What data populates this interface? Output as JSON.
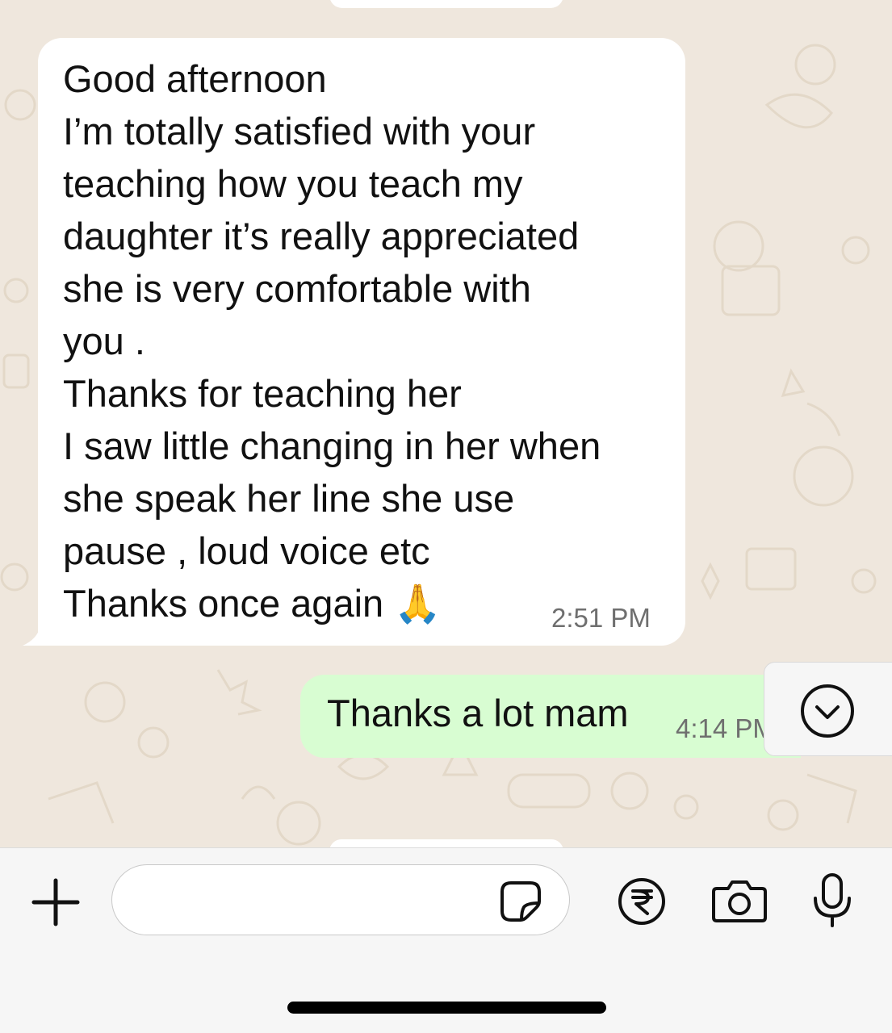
{
  "incoming_message": {
    "lines": [
      "Good afternoon",
      "I’m totally satisfied with your",
      "teaching how you teach my",
      "daughter it’s really appreciated",
      "she is very comfortable with",
      "you .",
      "Thanks for teaching her",
      "I saw little changing in her when",
      "she speak her line she use",
      "pause , loud voice etc",
      "Thanks once again 🙏"
    ],
    "time": "2:51 PM"
  },
  "outgoing_message": {
    "text": "Thanks a lot mam",
    "time": "4:14 PM"
  },
  "composer": {
    "input_value": "",
    "placeholder": ""
  },
  "colors": {
    "chat_background": "#efe7dd",
    "outgoing_bubble": "#d8fdd2",
    "incoming_bubble": "#ffffff",
    "composer_background": "#f6f6f6"
  },
  "icons": {
    "scroll_down": "chevron-down-circle-icon",
    "add": "plus-icon",
    "sticker": "sticker-icon",
    "payment": "rupee-icon",
    "camera": "camera-icon",
    "mic": "microphone-icon"
  }
}
